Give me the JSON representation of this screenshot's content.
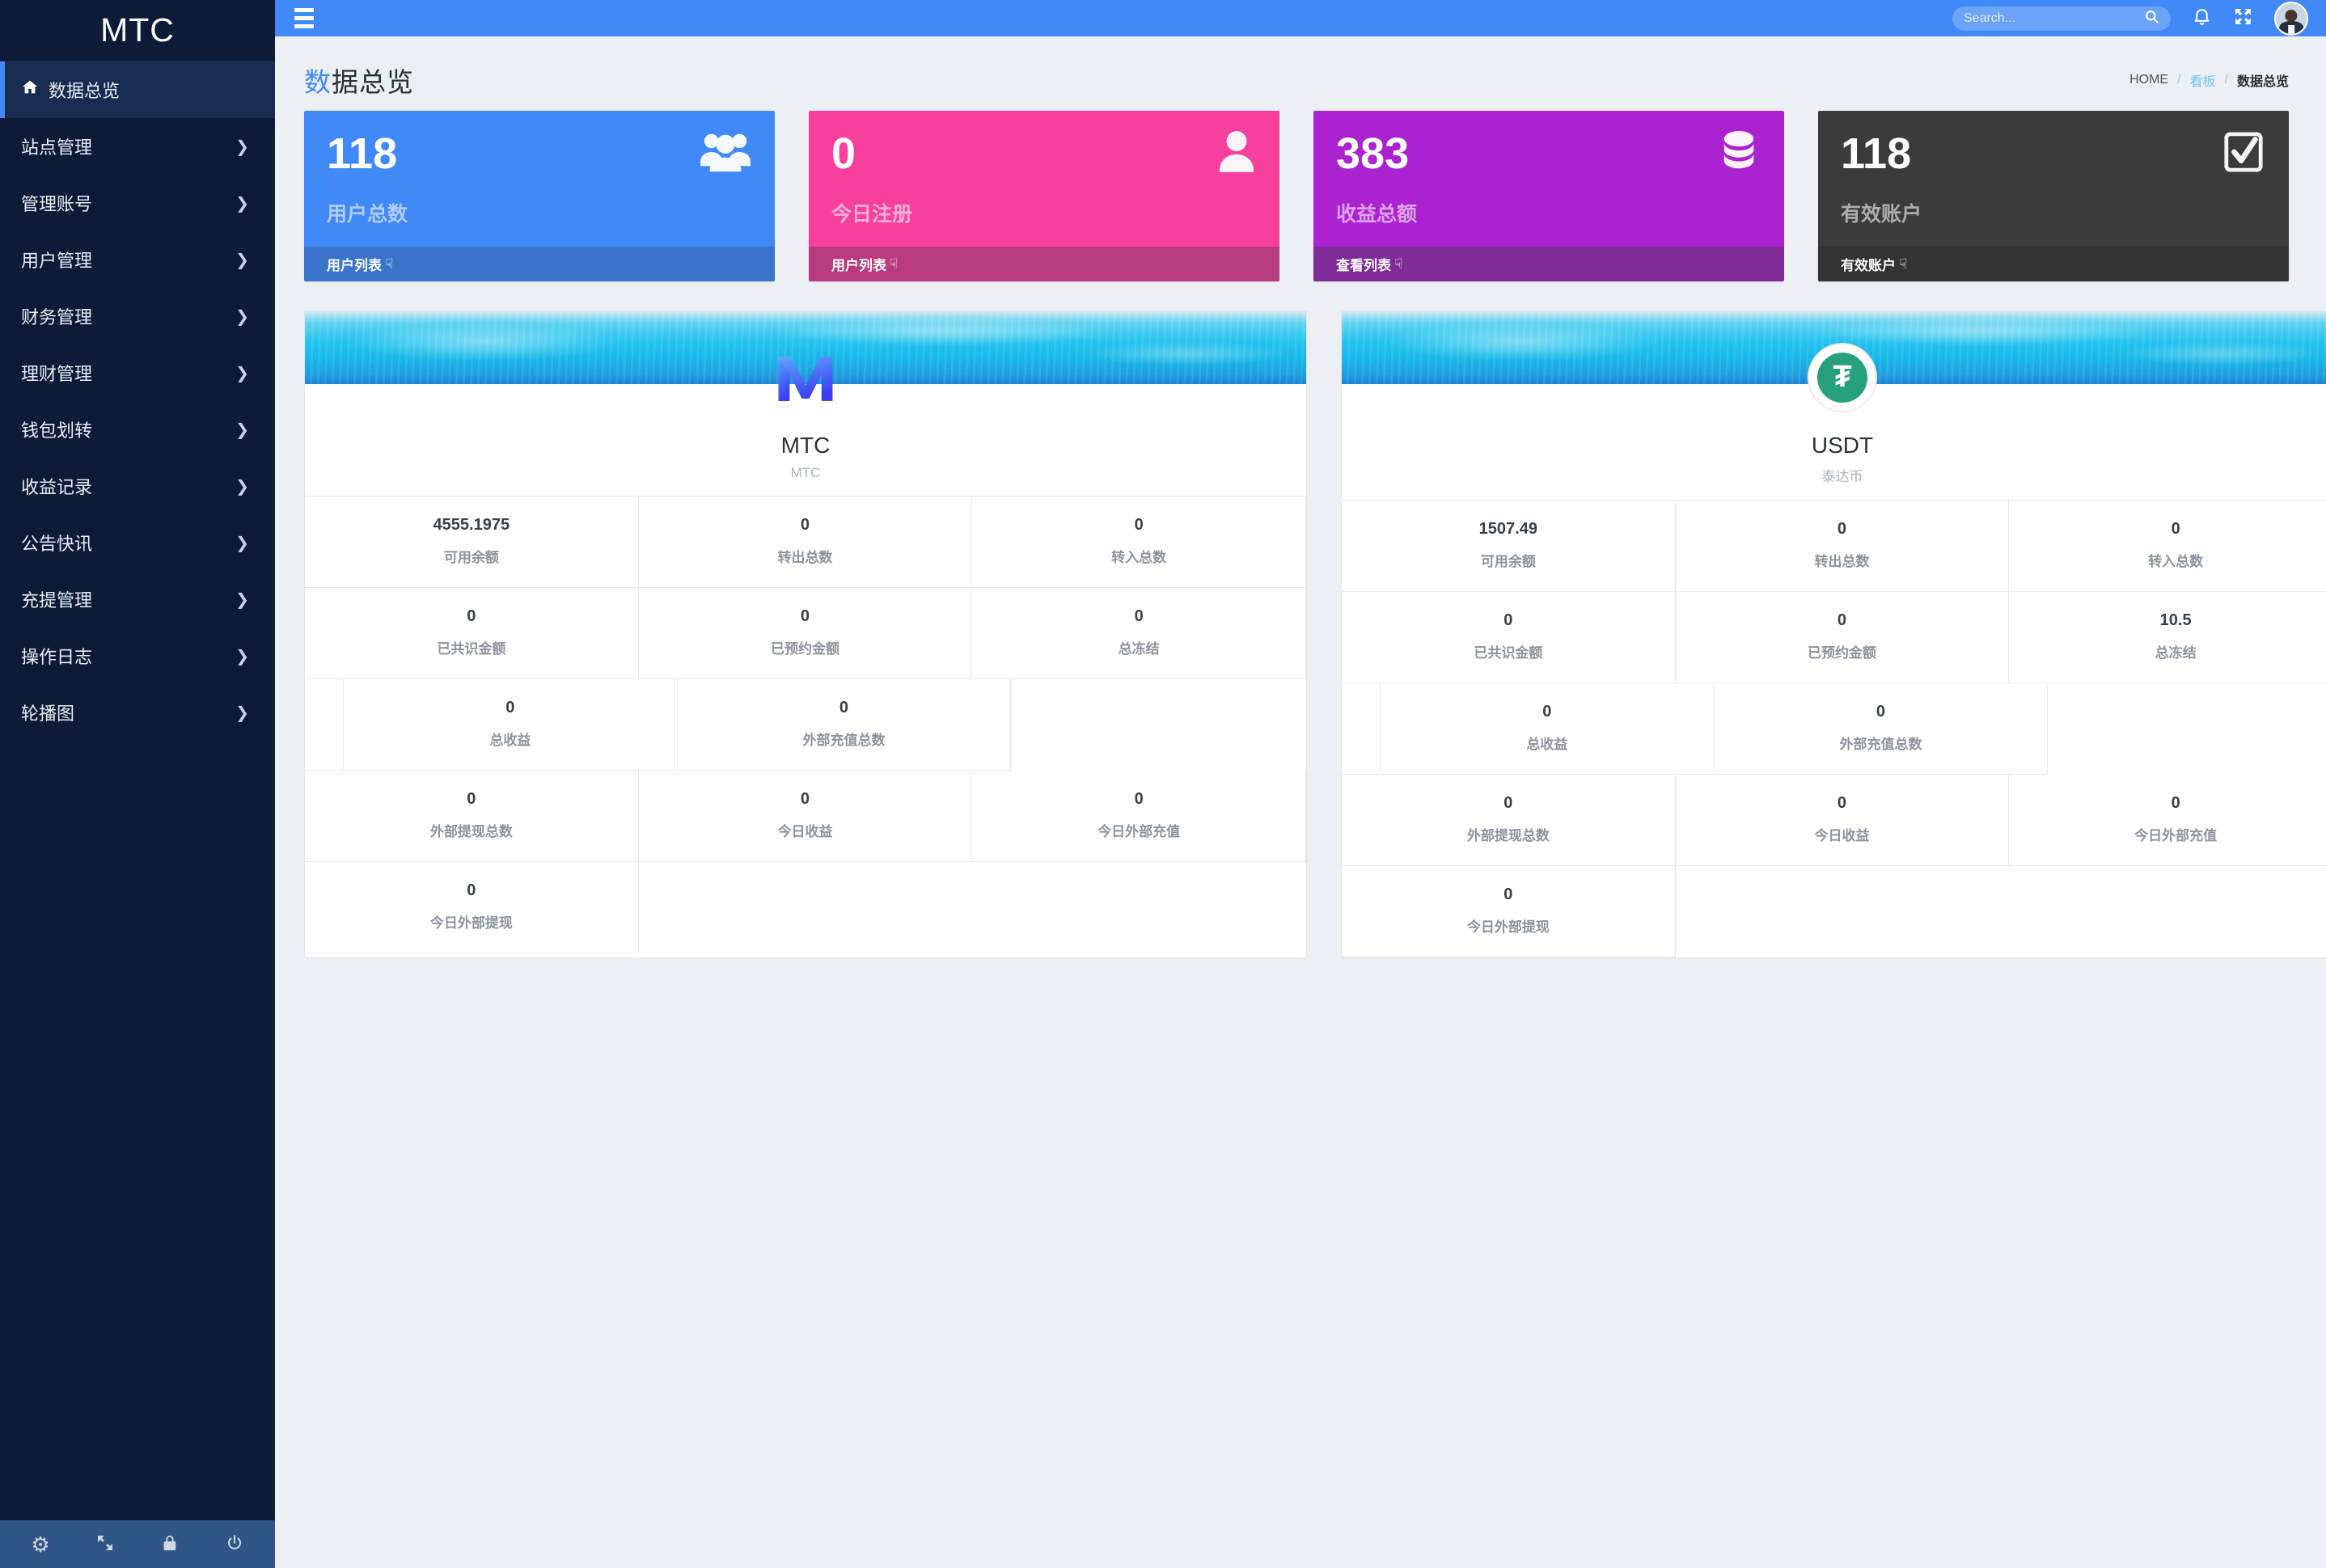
{
  "brand": {
    "title": "MTC"
  },
  "sidebar": {
    "items": [
      {
        "label": "数据总览",
        "icon": "home-icon",
        "active": true,
        "chevron": false
      },
      {
        "label": "站点管理",
        "icon": "",
        "active": false,
        "chevron": true
      },
      {
        "label": "管理账号",
        "icon": "",
        "active": false,
        "chevron": true
      },
      {
        "label": "用户管理",
        "icon": "",
        "active": false,
        "chevron": true
      },
      {
        "label": "财务管理",
        "icon": "",
        "active": false,
        "chevron": true
      },
      {
        "label": "理财管理",
        "icon": "",
        "active": false,
        "chevron": true
      },
      {
        "label": "钱包划转",
        "icon": "",
        "active": false,
        "chevron": true
      },
      {
        "label": "收益记录",
        "icon": "",
        "active": false,
        "chevron": true
      },
      {
        "label": "公告快讯",
        "icon": "",
        "active": false,
        "chevron": true
      },
      {
        "label": "充提管理",
        "icon": "",
        "active": false,
        "chevron": true
      },
      {
        "label": "操作日志",
        "icon": "",
        "active": false,
        "chevron": true
      },
      {
        "label": "轮播图",
        "icon": "",
        "active": false,
        "chevron": true
      }
    ],
    "footer_icons": [
      "gear-icon",
      "expand-icon",
      "lock-icon",
      "power-icon"
    ]
  },
  "topbar": {
    "menu_icon": "hamburger-icon",
    "search": {
      "placeholder": "Search...",
      "value": "",
      "icon": "search-icon"
    },
    "notification_icon": "bell-icon",
    "fullscreen_icon": "expand-icon",
    "avatar": "user-avatar"
  },
  "page": {
    "title_highlight": "数",
    "title_rest": "据总览",
    "breadcrumb": {
      "home": "HOME",
      "middle": "看板",
      "current": "数据总览",
      "separator": "/"
    }
  },
  "stat_cards": [
    {
      "value": "118",
      "label": "用户总数",
      "link": "用户列表",
      "icon": "users-group-icon",
      "color": "#4189f7"
    },
    {
      "value": "0",
      "label": "今日注册",
      "link": "用户列表",
      "icon": "user-icon",
      "color": "#f73f9e"
    },
    {
      "value": "383",
      "label": "收益总额",
      "link": "查看列表",
      "icon": "database-icon",
      "color": "#ab22d0"
    },
    {
      "value": "118",
      "label": "有效账户",
      "link": "有效账户",
      "icon": "check-square-icon",
      "color": "#3b3b3b"
    }
  ],
  "coin_panels": [
    {
      "name": "MTC",
      "subtitle": "MTC",
      "logo": "mtc-logo",
      "stats": [
        {
          "value": "4555.1975",
          "label": "可用余额"
        },
        {
          "value": "0",
          "label": "转出总数"
        },
        {
          "value": "0",
          "label": "转入总数"
        },
        {
          "value": "0",
          "label": "已共识金额"
        },
        {
          "value": "0",
          "label": "已预约金额"
        },
        {
          "value": "0",
          "label": "总冻结"
        },
        {
          "value": "0",
          "label": "总收益"
        },
        {
          "value": "0",
          "label": "外部充值总数"
        },
        {
          "value": "0",
          "label": "外部提现总数"
        },
        {
          "value": "0",
          "label": "今日收益"
        },
        {
          "value": "0",
          "label": "今日外部充值"
        },
        {
          "value": "0",
          "label": "今日外部提现"
        }
      ]
    },
    {
      "name": "USDT",
      "subtitle": "泰达币",
      "logo": "usdt-logo",
      "stats": [
        {
          "value": "1507.49",
          "label": "可用余额"
        },
        {
          "value": "0",
          "label": "转出总数"
        },
        {
          "value": "0",
          "label": "转入总数"
        },
        {
          "value": "0",
          "label": "已共识金额"
        },
        {
          "value": "0",
          "label": "已预约金额"
        },
        {
          "value": "10.5",
          "label": "总冻结"
        },
        {
          "value": "0",
          "label": "总收益"
        },
        {
          "value": "0",
          "label": "外部充值总数"
        },
        {
          "value": "0",
          "label": "外部提现总数"
        },
        {
          "value": "0",
          "label": "今日收益"
        },
        {
          "value": "0",
          "label": "今日外部充值"
        },
        {
          "value": "0",
          "label": "今日外部提现"
        }
      ]
    }
  ],
  "colors": {
    "sidebar_bg": "#0d1b38",
    "topbar_blue": "#4189f7",
    "accent": "#4189f7",
    "pink": "#f73f9e",
    "purple": "#ab22d0",
    "dark": "#3b3b3b",
    "usdt_green": "#26a17b"
  }
}
